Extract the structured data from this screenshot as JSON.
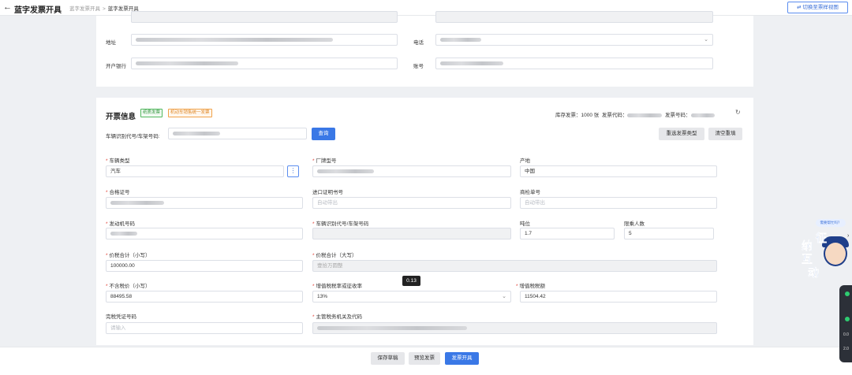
{
  "header": {
    "back_icon": "←",
    "title": "蓝字发票开具",
    "breadcrumb": [
      "蓝字发票开具",
      "蓝字发票开具"
    ],
    "switch_button": "切换至票样视图"
  },
  "buyer": {
    "address_label": "地址",
    "phone_label": "电话",
    "bank_label": "开户银行",
    "account_label": "账号"
  },
  "invoice": {
    "section_title": "开票信息",
    "tags": [
      "纸质发票",
      "机动车销售统一发票"
    ],
    "stock_label": "库存发票：1000 张",
    "code_label": "发票代码：",
    "number_label": "发票号码：",
    "vin_search_label": "车辆识别代号/车架号码:",
    "query_button": "查询",
    "reselect_button": "重选发票类型",
    "clear_button": "清空重填"
  },
  "fields": {
    "vehicle_type": {
      "label": "车辆类型",
      "value": "汽车"
    },
    "brand_model": {
      "label": "厂牌型号"
    },
    "origin": {
      "label": "产地",
      "value": "中国"
    },
    "certificate_no": {
      "label": "合格证号"
    },
    "import_cert_no": {
      "label": "进口证明书号",
      "placeholder": "自动带出"
    },
    "inspection_no": {
      "label": "商检单号",
      "placeholder": "自动带出"
    },
    "engine_no": {
      "label": "发动机号码"
    },
    "vin": {
      "label": "车辆识别代号/车架号码"
    },
    "tonnage": {
      "label": "吨位",
      "value": "1.7"
    },
    "seats": {
      "label": "限乘人数",
      "value": "5"
    },
    "total_small": {
      "label": "价税合计（小写）",
      "value": "100000.00"
    },
    "total_large": {
      "label": "价税合计（大写）",
      "value": "壹拾万圆整"
    },
    "price_excl_tax": {
      "label": "不含税价（小写）",
      "value": "88495.58"
    },
    "vat_rate": {
      "label": "增值税税率或征收率",
      "value": "13%"
    },
    "vat_amount": {
      "label": "增值税税额",
      "value": "11504.42"
    },
    "tax_cert_no": {
      "label": "完税凭证号码",
      "placeholder": "请输入"
    },
    "tax_authority": {
      "label": "主管税务机关及代码"
    }
  },
  "tooltip": "0.13",
  "actions": {
    "save_draft": "保存草稿",
    "preview": "预览发票",
    "issue": "发票开具"
  },
  "float_widget": {
    "question": "需要帮忙吗？",
    "mascot_chars": [
      "征",
      "纳",
      "互",
      "动"
    ]
  },
  "side_panel": {
    "values": [
      "0.0",
      "2.0"
    ]
  },
  "colors": {
    "primary": "#3a78e6",
    "required": "#e0453a"
  }
}
